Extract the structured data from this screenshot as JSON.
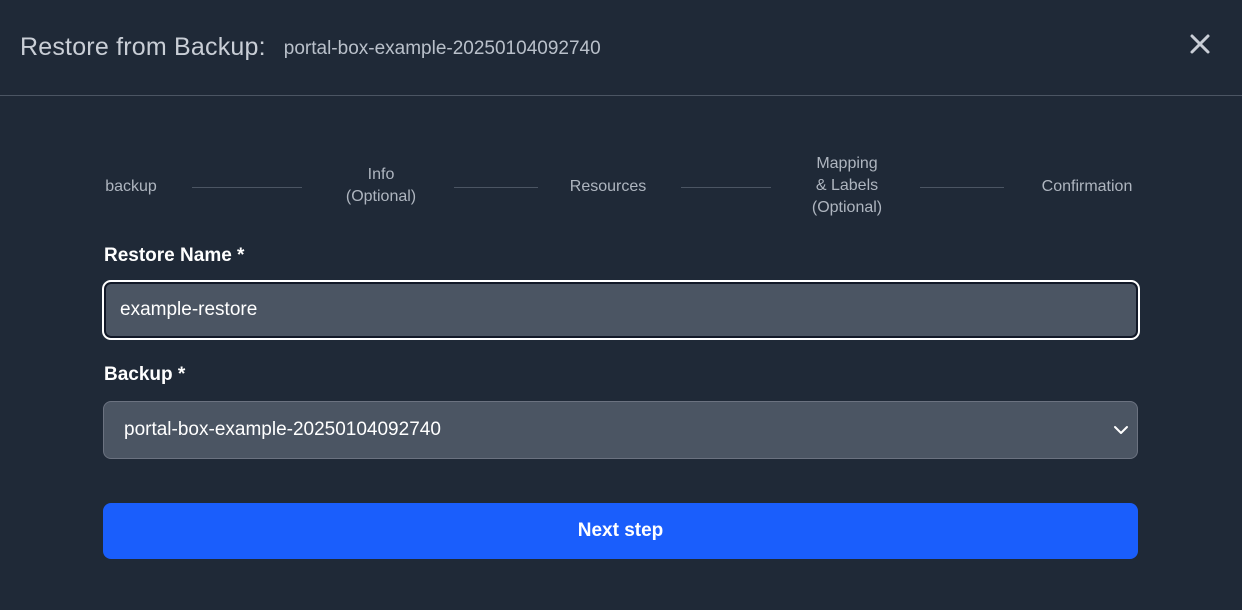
{
  "header": {
    "title": "Restore from Backup:",
    "subtitle": "portal-box-example-20250104092740",
    "close_icon": "close-icon"
  },
  "stepper": {
    "steps": [
      {
        "label": "backup"
      },
      {
        "label": "Info\n(Optional)"
      },
      {
        "label": "Resources"
      },
      {
        "label": "Mapping\n& Labels\n(Optional)"
      },
      {
        "label": "Confirmation"
      }
    ]
  },
  "form": {
    "restore_name": {
      "label": "Restore Name *",
      "value": "example-restore"
    },
    "backup": {
      "label": "Backup *",
      "selected": "portal-box-example-20250104092740",
      "chevron_icon": "chevron-down-icon"
    },
    "next_button": "Next step"
  },
  "colors": {
    "background": "#1f2937",
    "input_bg": "#4b5563",
    "accent": "#1a5efc"
  }
}
